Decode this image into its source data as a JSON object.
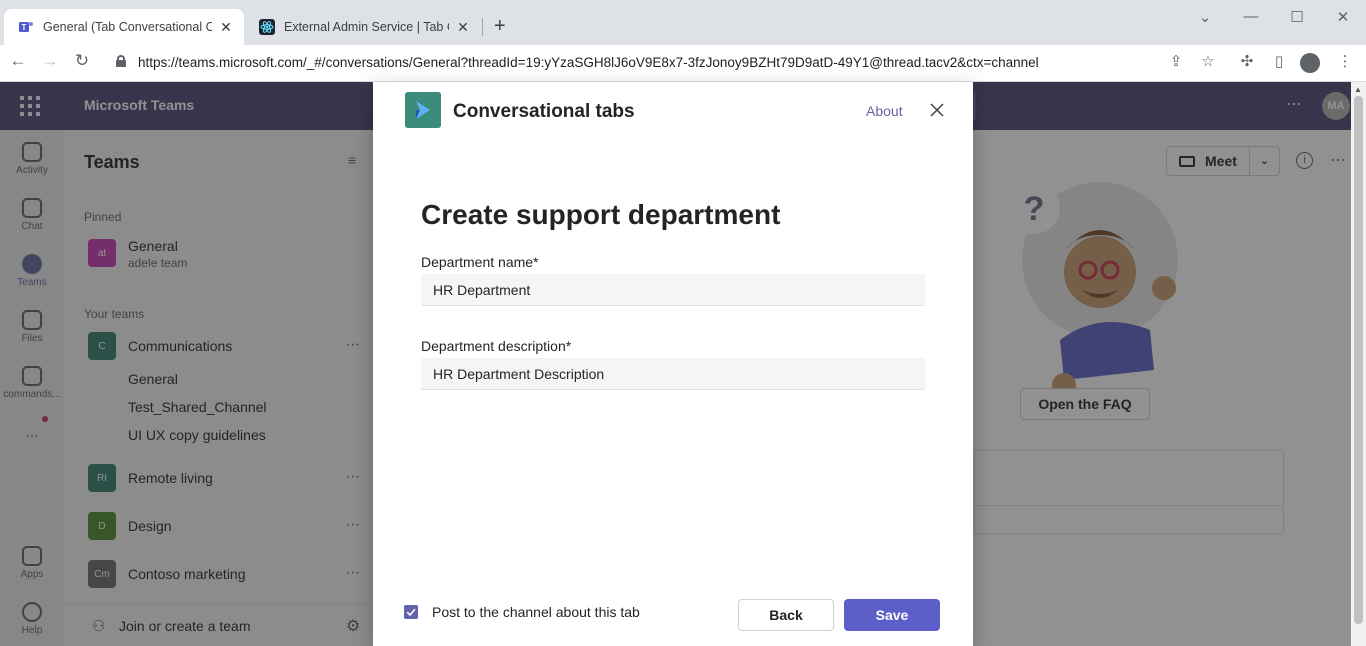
{
  "browser": {
    "tabs": [
      {
        "title": "General (Tab Conversational Char",
        "active": true,
        "favicon": "teams-logo-icon"
      },
      {
        "title": "External Admin Service | Tab Con",
        "active": false,
        "favicon": "react-logo-icon"
      }
    ],
    "url": "https://teams.microsoft.com/_#/conversations/General?threadId=19:yYzaSGH8lJ6oV9E8x7-3fzJonoy9BZHt79D9atD-49Y1@thread.tacv2&ctx=channel"
  },
  "teams": {
    "app_title": "Microsoft Teams",
    "user_initials": "MA",
    "rail": [
      {
        "label": "Activity",
        "icon": "bell-icon"
      },
      {
        "label": "Chat",
        "icon": "chat-icon"
      },
      {
        "label": "Teams",
        "icon": "teams-icon",
        "active": true
      },
      {
        "label": "Files",
        "icon": "file-icon"
      },
      {
        "label": "commands...",
        "icon": "app-r-icon"
      },
      {
        "label": "...",
        "icon": "more-apps-icon"
      },
      {
        "label": "Apps",
        "icon": "apps-icon"
      },
      {
        "label": "Help",
        "icon": "help-icon"
      }
    ],
    "left_pane": {
      "title": "Teams",
      "pinned_label": "Pinned",
      "pinned": {
        "initials": "at",
        "name": "General",
        "sub": "adele team"
      },
      "your_teams_label": "Your teams",
      "teams": [
        {
          "initials": "C",
          "name": "Communications",
          "color": "#2e7d6b",
          "channels": [
            "General",
            "Test_Shared_Channel",
            "UI UX copy guidelines"
          ]
        },
        {
          "initials": "RI",
          "name": "Remote living",
          "color": "#2e7d6b"
        },
        {
          "initials": "D",
          "name": "Design",
          "color": "#4b8a2e"
        },
        {
          "initials": "Cm",
          "name": "Contoso marketing",
          "color": "#6b6b6b"
        }
      ],
      "join_label": "Join or create a team"
    },
    "main": {
      "meet_label": "Meet",
      "faq_button": "Open the FAQ"
    }
  },
  "dialog": {
    "app_name": "Conversational tabs",
    "about_label": "About",
    "form_title": "Create support department",
    "fields": [
      {
        "label": "Department name*",
        "value": "HR Department"
      },
      {
        "label": "Department description*",
        "value": "HR Department Description"
      }
    ],
    "post_checkbox": {
      "label": "Post to the channel about this tab",
      "checked": true
    },
    "back_label": "Back",
    "save_label": "Save",
    "colors": {
      "primary": "#5b5fc7",
      "app_icon_bg": "#3c8c7c"
    }
  }
}
